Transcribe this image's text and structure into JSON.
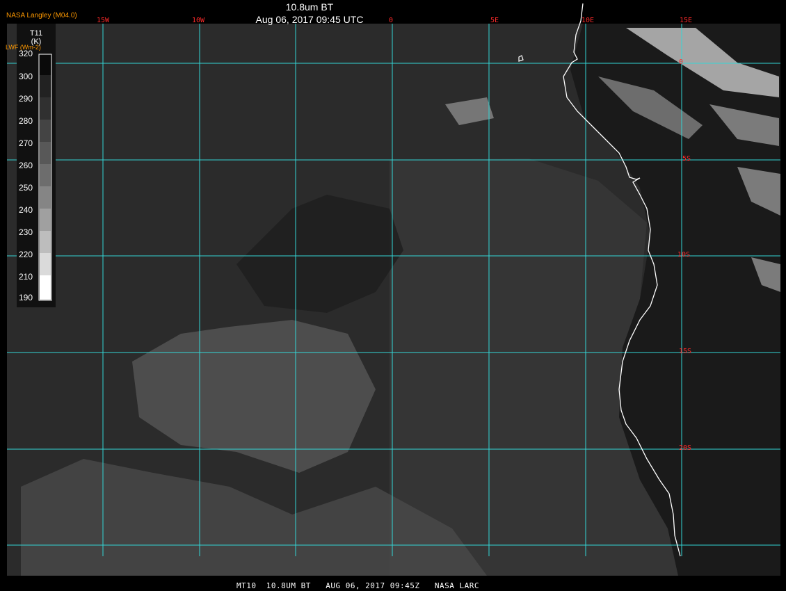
{
  "header": {
    "org_label": "NASA Langley (M04.0)",
    "product_title": "10.8um BT",
    "datetime": "Aug 06, 2017 09:45 UTC",
    "units_label": "LWF (Wm-2)"
  },
  "colorbar": {
    "title_line1": "T11",
    "title_line2": "(K)",
    "labels": [
      "320",
      "300",
      "290",
      "280",
      "270",
      "260",
      "250",
      "240",
      "230",
      "220",
      "210",
      "190"
    ]
  },
  "grid": {
    "lon_labels": [
      "15W",
      "10W",
      "0",
      "5E",
      "10E",
      "15E"
    ],
    "lat_labels": [
      "0",
      "5S",
      "10S",
      "15S",
      "20S"
    ]
  },
  "footer": {
    "text": "MT10  10.8UM BT   AUG 06, 2017 09:45Z   NASA LARC"
  },
  "colors": {
    "grid_line": "#33d6d6",
    "coastline": "#ffffff",
    "grid_label": "#ff2a2a",
    "org_label": "#ff9900"
  }
}
